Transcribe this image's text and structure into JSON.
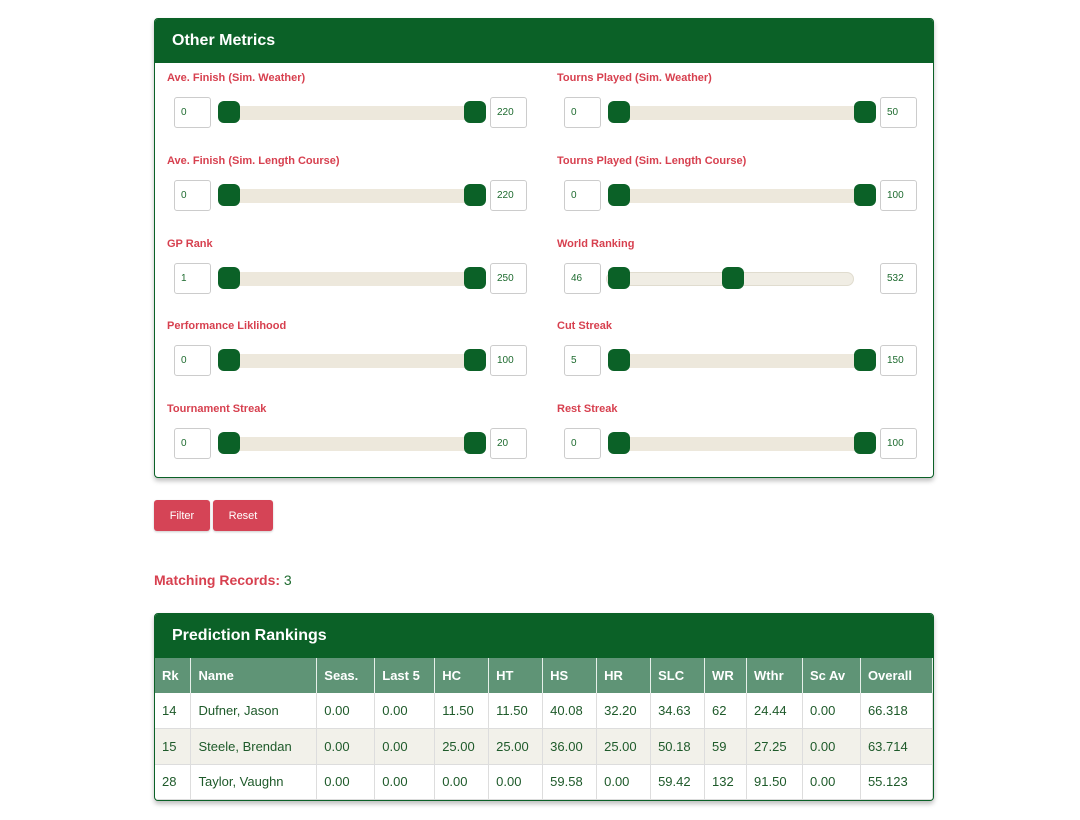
{
  "metrics_panel": {
    "title": "Other Metrics",
    "sliders": [
      {
        "label": "Ave. Finish (Sim. Weather)",
        "min": "0",
        "max": "220",
        "low_pct": 0,
        "high_pct": 100
      },
      {
        "label": "Tourns Played (Sim. Weather)",
        "min": "0",
        "max": "50",
        "low_pct": 0,
        "high_pct": 100
      },
      {
        "label": "Ave. Finish (Sim. Length Course)",
        "min": "0",
        "max": "220",
        "low_pct": 0,
        "high_pct": 100
      },
      {
        "label": "Tourns Played (Sim. Length Course)",
        "min": "0",
        "max": "100",
        "low_pct": 0,
        "high_pct": 100
      },
      {
        "label": "GP Rank",
        "min": "1",
        "max": "250",
        "low_pct": 0,
        "high_pct": 100
      },
      {
        "label": "World Ranking",
        "min": "46",
        "max": "532",
        "low_pct": 0,
        "high_pct": 51
      },
      {
        "label": "Performance Liklihood",
        "min": "0",
        "max": "100",
        "low_pct": 0,
        "high_pct": 100
      },
      {
        "label": "Cut Streak",
        "min": "5",
        "max": "150",
        "low_pct": 0,
        "high_pct": 100
      },
      {
        "label": "Tournament Streak",
        "min": "0",
        "max": "20",
        "low_pct": 0,
        "high_pct": 100
      },
      {
        "label": "Rest Streak",
        "min": "0",
        "max": "100",
        "low_pct": 0,
        "high_pct": 100
      }
    ]
  },
  "buttons": {
    "filter": "Filter",
    "reset": "Reset"
  },
  "matching": {
    "label": "Matching Records:",
    "count": "3"
  },
  "rankings": {
    "title": "Prediction Rankings",
    "columns": [
      "Rk",
      "Name",
      "Seas.",
      "Last 5",
      "HC",
      "HT",
      "HS",
      "HR",
      "SLC",
      "WR",
      "Wthr",
      "Sc Av",
      "Overall"
    ],
    "rows": [
      [
        "14",
        "Dufner, Jason",
        "0.00",
        "0.00",
        "11.50",
        "11.50",
        "40.08",
        "32.20",
        "34.63",
        "62",
        "24.44",
        "0.00",
        "66.318"
      ],
      [
        "15",
        "Steele, Brendan",
        "0.00",
        "0.00",
        "25.00",
        "25.00",
        "36.00",
        "25.00",
        "50.18",
        "59",
        "27.25",
        "0.00",
        "63.714"
      ],
      [
        "28",
        "Taylor, Vaughn",
        "0.00",
        "0.00",
        "0.00",
        "0.00",
        "59.58",
        "0.00",
        "59.42",
        "132",
        "91.50",
        "0.00",
        "55.123"
      ]
    ]
  }
}
